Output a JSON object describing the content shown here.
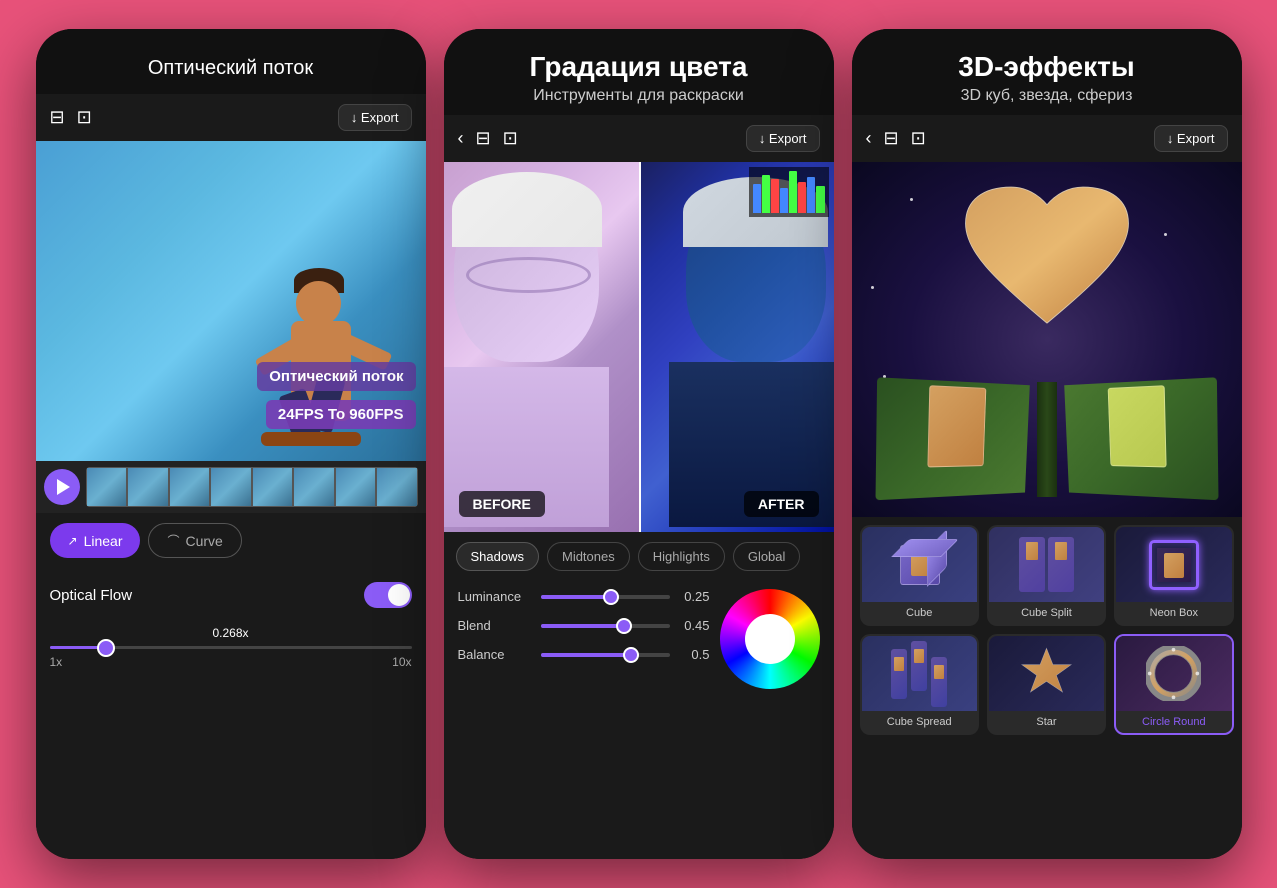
{
  "background_color": "#e8527a",
  "phones": [
    {
      "id": "phone1",
      "title": "Оптический поток",
      "toolbar": {
        "export_label": "↓ Export"
      },
      "overlay_text1": "Оптический поток",
      "overlay_text2": "24FPS To 960FPS",
      "tabs": [
        {
          "label": "Linear",
          "active": true
        },
        {
          "label": "Curve",
          "active": false
        }
      ],
      "optical_flow_label": "Optical Flow",
      "speed_min": "1x",
      "speed_max": "10x",
      "speed_value": "0.268x"
    },
    {
      "id": "phone2",
      "title": "Градация цвета",
      "subtitle": "Инструменты для раскраски",
      "toolbar": {
        "export_label": "↓ Export"
      },
      "labels": {
        "before": "BEFORE",
        "after": "AFTER"
      },
      "tone_tabs": [
        {
          "label": "Shadows",
          "active": true
        },
        {
          "label": "Midtones",
          "active": false
        },
        {
          "label": "Highlights",
          "active": false
        },
        {
          "label": "Global",
          "active": false
        }
      ],
      "sliders": [
        {
          "label": "Luminance",
          "value": 0.25,
          "fill_percent": 55
        },
        {
          "label": "Blend",
          "value": 0.45,
          "fill_percent": 65
        },
        {
          "label": "Balance",
          "value": 0.5,
          "fill_percent": 70
        }
      ]
    },
    {
      "id": "phone3",
      "title": "3D-эффекты",
      "subtitle": "3D куб, звезда, сфериз",
      "toolbar": {
        "export_label": "↓ Export"
      },
      "effects": [
        {
          "label": "Cube",
          "selected": false
        },
        {
          "label": "Cube Split",
          "selected": false
        },
        {
          "label": "Neon Box",
          "selected": false
        },
        {
          "label": "Cube Spread",
          "selected": false
        },
        {
          "label": "Star",
          "selected": false
        },
        {
          "label": "Circle Round",
          "selected": true
        }
      ]
    }
  ]
}
